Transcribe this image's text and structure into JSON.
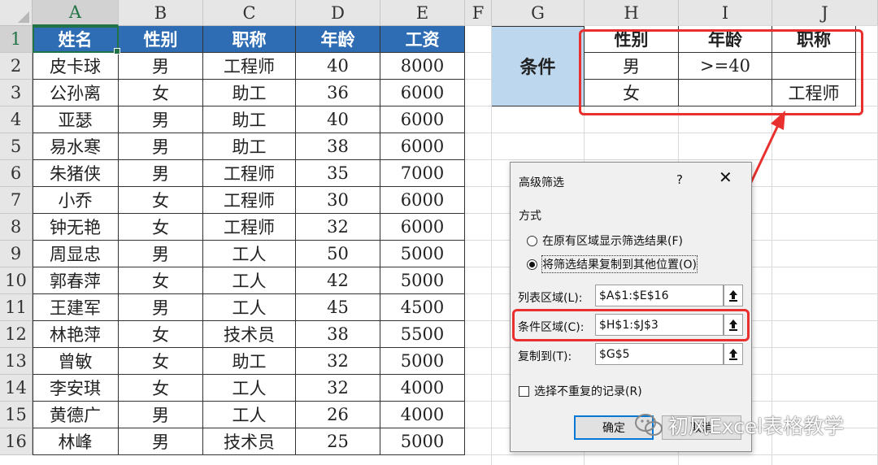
{
  "columns": [
    "A",
    "B",
    "C",
    "D",
    "E",
    "F",
    "G",
    "H",
    "I",
    "J"
  ],
  "selected_column": "A",
  "rows": [
    "1",
    "2",
    "3",
    "4",
    "5",
    "6",
    "7",
    "8",
    "9",
    "10",
    "11",
    "12",
    "13",
    "14",
    "15",
    "16"
  ],
  "selected_row": "1",
  "table": {
    "headers": [
      "姓名",
      "性别",
      "职称",
      "年龄",
      "工资"
    ],
    "records": [
      [
        "皮卡球",
        "男",
        "工程师",
        "40",
        "8000"
      ],
      [
        "公孙离",
        "女",
        "助工",
        "36",
        "6000"
      ],
      [
        "亚瑟",
        "男",
        "助工",
        "40",
        "6000"
      ],
      [
        "易水寒",
        "男",
        "助工",
        "38",
        "6000"
      ],
      [
        "朱猪侠",
        "男",
        "工程师",
        "35",
        "7000"
      ],
      [
        "小乔",
        "女",
        "工程师",
        "30",
        "6000"
      ],
      [
        "钟无艳",
        "女",
        "工程师",
        "32",
        "6000"
      ],
      [
        "周显忠",
        "男",
        "工人",
        "50",
        "5000"
      ],
      [
        "郭春萍",
        "女",
        "工人",
        "42",
        "5000"
      ],
      [
        "王建军",
        "男",
        "工人",
        "45",
        "4500"
      ],
      [
        "林艳萍",
        "女",
        "技术员",
        "38",
        "5500"
      ],
      [
        "曾敏",
        "女",
        "助工",
        "32",
        "5000"
      ],
      [
        "李安琪",
        "女",
        "工人",
        "32",
        "4000"
      ],
      [
        "黄德广",
        "男",
        "工人",
        "26",
        "4000"
      ],
      [
        "林峰",
        "男",
        "技术员",
        "25",
        "5000"
      ]
    ]
  },
  "criteria": {
    "label": "条件",
    "headers": [
      "性别",
      "年龄",
      "职称"
    ],
    "rows": [
      [
        "男",
        ">=40",
        ""
      ],
      [
        "女",
        "",
        "工程师"
      ]
    ]
  },
  "dialog": {
    "title": "高级筛选",
    "help": "?",
    "close": "✕",
    "section": "方式",
    "option1": "在原有区域显示筛选结果(F)",
    "option2": "将筛选结果复制到其他位置(O)",
    "selected_option": 2,
    "list_label": "列表区域(L):",
    "list_value": "$A$1:$E$16",
    "criteria_label": "条件区域(C):",
    "criteria_value": "$H$1:$J$3",
    "copy_label": "复制到(T):",
    "copy_value": "$G$5",
    "unique_label": "选择不重复的记录(R)",
    "ok": "确定",
    "cancel": "取消"
  },
  "watermark": "初风Excel表格教学",
  "colors": {
    "header_fill": "#2e6db4",
    "label_fill": "#bdd7ee",
    "highlight": "#e8302e",
    "dialog_bg": "#f0f0f0"
  }
}
